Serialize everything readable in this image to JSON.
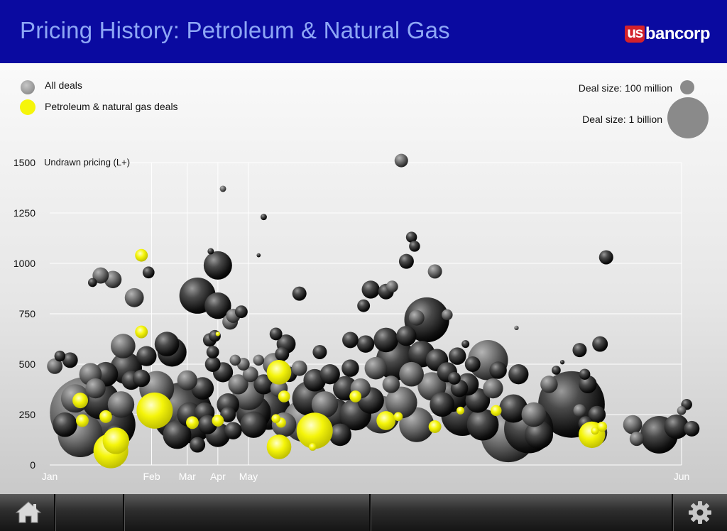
{
  "header": {
    "title": "Pricing History: Petroleum & Natural Gas",
    "logo_prefix": "us",
    "logo_name": "bancorp"
  },
  "legend": {
    "all_deals": "All deals",
    "petroleum_deals": "Petroleum & natural gas deals",
    "size_small": "Deal size: 100 million",
    "size_large": "Deal size: 1 billion"
  },
  "colors": {
    "header_bg": "#0a0aa0",
    "title": "#8ea7f5",
    "all_deals": "#8a8a8a",
    "petroleum": "#f5f50a",
    "logo_red": "#d3222b"
  },
  "toolbar": {
    "home_icon": "home-icon",
    "settings_icon": "gear-icon"
  },
  "chart_data": {
    "type": "scatter",
    "bubble": true,
    "ylabel": "Undrawn pricing (L+)",
    "xlabel": "",
    "x_tick_labels": [
      "Jan",
      "Feb",
      "Mar",
      "Apr",
      "May",
      "Jun"
    ],
    "x_tick_values": [
      0,
      1,
      1.35,
      1.65,
      1.95,
      6.2
    ],
    "xlim": [
      0,
      6.2
    ],
    "yticks": [
      0,
      250,
      500,
      750,
      1000,
      1250,
      1500
    ],
    "ylim": [
      0,
      1500
    ],
    "grid": true,
    "legend_position": "top",
    "size_unit_millions": [
      100,
      1000
    ],
    "series": [
      {
        "name": "All deals",
        "points": [
          [
            0.35,
            260,
            2500
          ],
          [
            0.6,
            200,
            1200
          ],
          [
            0.3,
            150,
            1000
          ],
          [
            0.25,
            330,
            400
          ],
          [
            0.5,
            320,
            700
          ],
          [
            0.4,
            450,
            250
          ],
          [
            0.55,
            450,
            300
          ],
          [
            0.75,
            480,
            500
          ],
          [
            0.45,
            380,
            200
          ],
          [
            0.8,
            420,
            180
          ],
          [
            0.7,
            300,
            350
          ],
          [
            0.65,
            150,
            200
          ],
          [
            0.15,
            200,
            300
          ],
          [
            0.2,
            520,
            120
          ],
          [
            0.1,
            540,
            60
          ],
          [
            0.5,
            940,
            130
          ],
          [
            0.62,
            920,
            150
          ],
          [
            0.42,
            905,
            40
          ],
          [
            0.83,
            830,
            180
          ],
          [
            0.72,
            590,
            300
          ],
          [
            0.95,
            540,
            200
          ],
          [
            0.9,
            430,
            150
          ],
          [
            1.2,
            560,
            420
          ],
          [
            1.05,
            380,
            600
          ],
          [
            1.3,
            260,
            1800
          ],
          [
            1.15,
            600,
            300
          ],
          [
            1.4,
            200,
            700
          ],
          [
            1.35,
            420,
            200
          ],
          [
            1.5,
            380,
            250
          ],
          [
            1.25,
            150,
            400
          ],
          [
            0.97,
            955,
            70
          ],
          [
            1.45,
            840,
            650
          ],
          [
            1.65,
            990,
            400
          ],
          [
            1.65,
            790,
            350
          ],
          [
            1.8,
            740,
            100
          ],
          [
            1.88,
            760,
            80
          ],
          [
            1.77,
            710,
            120
          ],
          [
            1.57,
            620,
            90
          ],
          [
            1.52,
            260,
            200
          ],
          [
            1.6,
            500,
            120
          ],
          [
            1.6,
            560,
            80
          ],
          [
            1.7,
            460,
            200
          ],
          [
            1.75,
            300,
            250
          ],
          [
            1.65,
            150,
            300
          ],
          [
            1.85,
            400,
            200
          ],
          [
            1.95,
            350,
            500
          ],
          [
            1.8,
            170,
            150
          ],
          [
            2.0,
            200,
            350
          ],
          [
            1.55,
            200,
            180
          ],
          [
            1.45,
            100,
            120
          ],
          [
            1.9,
            500,
            80
          ],
          [
            1.97,
            450,
            120
          ],
          [
            1.75,
            250,
            120
          ],
          [
            2.05,
            520,
            60
          ],
          [
            2.0,
            260,
            600
          ],
          [
            2.1,
            400,
            200
          ],
          [
            2.15,
            280,
            900
          ],
          [
            2.2,
            500,
            250
          ],
          [
            2.25,
            380,
            150
          ],
          [
            2.3,
            200,
            300
          ],
          [
            2.35,
            450,
            120
          ],
          [
            2.28,
            550,
            100
          ],
          [
            2.32,
            600,
            180
          ],
          [
            2.45,
            480,
            120
          ],
          [
            2.55,
            330,
            600
          ],
          [
            2.5,
            220,
            900
          ],
          [
            2.6,
            420,
            250
          ],
          [
            2.65,
            560,
            100
          ],
          [
            2.7,
            300,
            350
          ],
          [
            2.75,
            450,
            200
          ],
          [
            2.8,
            250,
            500
          ],
          [
            2.9,
            380,
            300
          ],
          [
            2.85,
            150,
            250
          ],
          [
            2.95,
            480,
            150
          ],
          [
            3.0,
            250,
            500
          ],
          [
            3.05,
            380,
            200
          ],
          [
            3.1,
            600,
            150
          ],
          [
            3.15,
            320,
            350
          ],
          [
            3.2,
            480,
            250
          ],
          [
            3.25,
            250,
            700
          ],
          [
            3.3,
            620,
            300
          ],
          [
            3.35,
            400,
            150
          ],
          [
            3.4,
            520,
            800
          ],
          [
            3.45,
            310,
            500
          ],
          [
            3.5,
            640,
            200
          ],
          [
            3.55,
            450,
            300
          ],
          [
            3.6,
            200,
            600
          ],
          [
            3.65,
            550,
            350
          ],
          [
            3.7,
            720,
            1000
          ],
          [
            3.75,
            390,
            400
          ],
          [
            3.8,
            520,
            250
          ],
          [
            3.85,
            300,
            300
          ],
          [
            3.9,
            460,
            200
          ],
          [
            3.95,
            350,
            600
          ],
          [
            4.0,
            540,
            150
          ],
          [
            4.05,
            250,
            900
          ],
          [
            4.1,
            400,
            250
          ],
          [
            4.15,
            500,
            120
          ],
          [
            4.2,
            320,
            300
          ],
          [
            4.25,
            200,
            500
          ],
          [
            4.3,
            520,
            800
          ],
          [
            4.35,
            380,
            200
          ],
          [
            4.4,
            470,
            150
          ],
          [
            4.5,
            150,
            1500
          ],
          [
            4.55,
            280,
            400
          ],
          [
            4.6,
            450,
            200
          ],
          [
            4.7,
            180,
            1200
          ],
          [
            4.75,
            250,
            300
          ],
          [
            4.8,
            150,
            400
          ],
          [
            4.9,
            400,
            150
          ],
          [
            3.15,
            870,
            160
          ],
          [
            3.3,
            860,
            120
          ],
          [
            3.08,
            790,
            80
          ],
          [
            3.36,
            885,
            70
          ],
          [
            3.6,
            730,
            120
          ],
          [
            3.5,
            1010,
            110
          ],
          [
            3.55,
            1130,
            60
          ],
          [
            3.58,
            1085,
            60
          ],
          [
            3.78,
            960,
            100
          ],
          [
            3.9,
            745,
            60
          ],
          [
            3.97,
            430,
            80
          ],
          [
            4.08,
            600,
            30
          ],
          [
            4.02,
            380,
            150
          ],
          [
            4.97,
            470,
            40
          ],
          [
            5.12,
            300,
            2200
          ],
          [
            5.2,
            570,
            100
          ],
          [
            5.25,
            450,
            60
          ],
          [
            5.28,
            400,
            160
          ],
          [
            5.2,
            270,
            80
          ],
          [
            5.26,
            205,
            110
          ],
          [
            5.34,
            160,
            350
          ],
          [
            5.37,
            250,
            150
          ],
          [
            5.4,
            600,
            120
          ],
          [
            5.46,
            1030,
            100
          ],
          [
            5.72,
            200,
            180
          ],
          [
            5.76,
            130,
            100
          ],
          [
            5.98,
            150,
            700
          ],
          [
            6.15,
            190,
            300
          ],
          [
            6.25,
            300,
            60
          ],
          [
            6.2,
            270,
            40
          ],
          [
            6.3,
            180,
            120
          ],
          [
            5.03,
            510,
            10
          ],
          [
            2.45,
            850,
            100
          ],
          [
            2.05,
            1040,
            8
          ],
          [
            2.1,
            1230,
            20
          ],
          [
            1.7,
            1370,
            20
          ],
          [
            3.45,
            1510,
            90
          ],
          [
            1.62,
            640,
            70
          ],
          [
            1.58,
            1060,
            20
          ],
          [
            4.58,
            680,
            10
          ],
          [
            1.37,
            250,
            300
          ],
          [
            1.82,
            520,
            60
          ],
          [
            2.22,
            650,
            80
          ],
          [
            2.95,
            620,
            130
          ],
          [
            0.05,
            490,
            120
          ]
        ]
      },
      {
        "name": "Petroleum & natural gas deals",
        "points": [
          [
            0.3,
            320,
            120
          ],
          [
            0.32,
            220,
            80
          ],
          [
            0.6,
            70,
            600
          ],
          [
            0.65,
            120,
            350
          ],
          [
            0.55,
            240,
            80
          ],
          [
            0.9,
            1040,
            80
          ],
          [
            0.9,
            660,
            80
          ],
          [
            1.03,
            270,
            650
          ],
          [
            1.4,
            210,
            80
          ],
          [
            1.65,
            220,
            70
          ],
          [
            2.25,
            460,
            300
          ],
          [
            2.3,
            340,
            70
          ],
          [
            2.22,
            230,
            40
          ],
          [
            2.27,
            210,
            50
          ],
          [
            2.25,
            90,
            300
          ],
          [
            2.6,
            170,
            650
          ],
          [
            2.58,
            90,
            30
          ],
          [
            3.0,
            340,
            70
          ],
          [
            3.3,
            220,
            180
          ],
          [
            3.42,
            240,
            40
          ],
          [
            3.78,
            190,
            80
          ],
          [
            4.03,
            270,
            30
          ],
          [
            4.38,
            270,
            60
          ],
          [
            5.32,
            150,
            350
          ],
          [
            5.42,
            190,
            50
          ],
          [
            5.35,
            170,
            30
          ],
          [
            1.65,
            650,
            10
          ]
        ]
      }
    ]
  }
}
